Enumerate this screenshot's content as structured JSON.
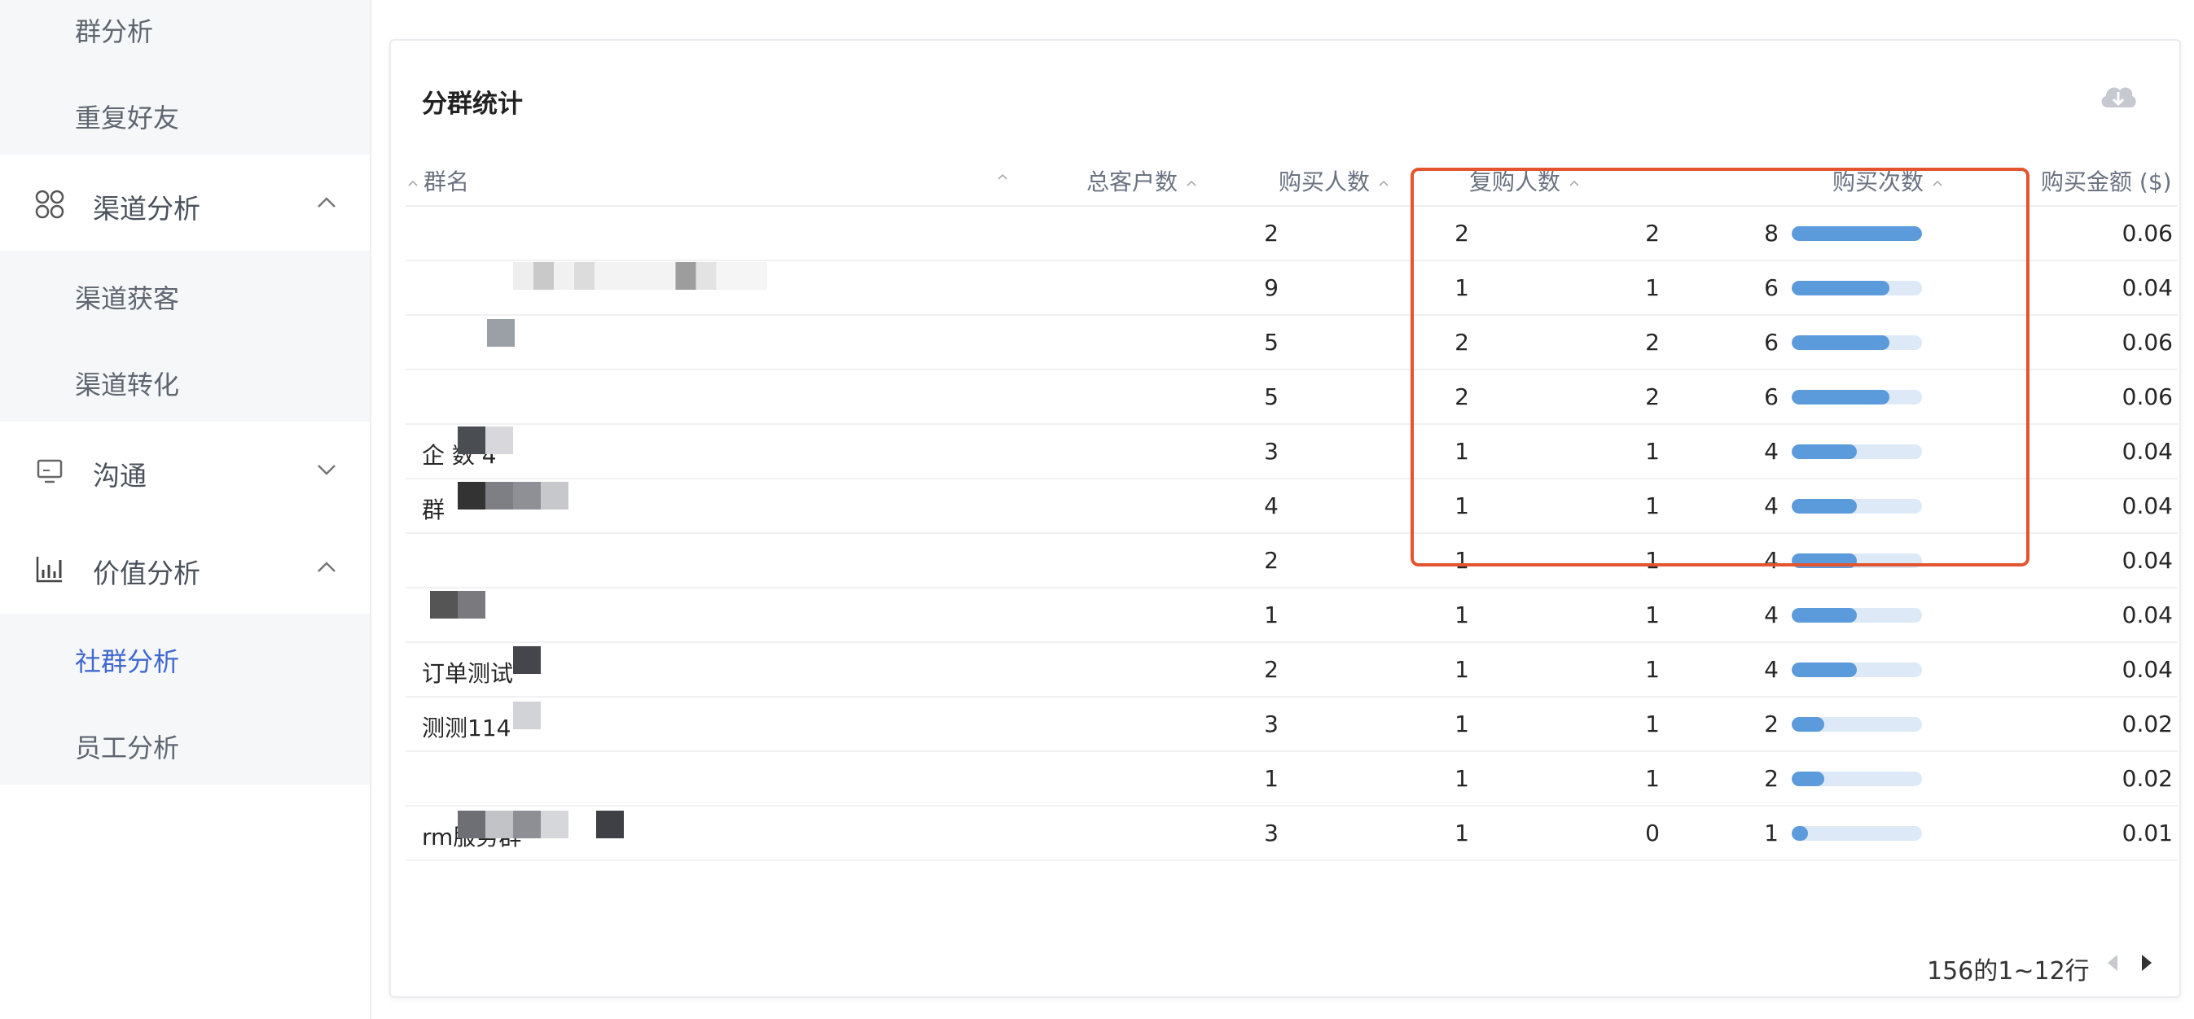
{
  "sidebar": {
    "top_items": [
      "群分析",
      "重复好友"
    ],
    "channel": {
      "label": "渠道分析",
      "icon": "channel-grid-icon",
      "items": [
        "渠道获客",
        "渠道转化"
      ]
    },
    "communication": {
      "label": "沟通",
      "icon": "monitor-icon"
    },
    "value": {
      "label": "价值分析",
      "icon": "bar-chart-icon",
      "items": [
        "社群分析",
        "员工分析"
      ],
      "active": "社群分析"
    }
  },
  "card": {
    "title": "分群统计",
    "download_icon": "cloud-download-icon",
    "columns": {
      "name": "群名",
      "total_customers": "总客户数",
      "buyers": "购买人数",
      "repeat_buyers": "复购人数",
      "purchase_count": "购买次数",
      "purchase_amount": "购买金额 ($)"
    },
    "rows": [
      {
        "name": "",
        "total": "2",
        "buyers": "2",
        "repeat": "2",
        "count": "8",
        "count_value": 8,
        "amount": "0.06"
      },
      {
        "name": "",
        "total": "9",
        "buyers": "1",
        "repeat": "1",
        "count": "6",
        "count_value": 6,
        "amount": "0.04"
      },
      {
        "name": "",
        "total": "5",
        "buyers": "2",
        "repeat": "2",
        "count": "6",
        "count_value": 6,
        "amount": "0.06"
      },
      {
        "name": "",
        "total": "5",
        "buyers": "2",
        "repeat": "2",
        "count": "6",
        "count_value": 6,
        "amount": "0.06"
      },
      {
        "name": "企 数 4",
        "total": "3",
        "buyers": "1",
        "repeat": "1",
        "count": "4",
        "count_value": 4,
        "amount": "0.04"
      },
      {
        "name": "群",
        "total": "4",
        "buyers": "1",
        "repeat": "1",
        "count": "4",
        "count_value": 4,
        "amount": "0.04"
      },
      {
        "name": "",
        "total": "2",
        "buyers": "1",
        "repeat": "1",
        "count": "4",
        "count_value": 4,
        "amount": "0.04"
      },
      {
        "name": "",
        "total": "1",
        "buyers": "1",
        "repeat": "1",
        "count": "4",
        "count_value": 4,
        "amount": "0.04"
      },
      {
        "name": "订单测试",
        "total": "2",
        "buyers": "1",
        "repeat": "1",
        "count": "4",
        "count_value": 4,
        "amount": "0.04"
      },
      {
        "name": "测测114",
        "total": "3",
        "buyers": "1",
        "repeat": "1",
        "count": "2",
        "count_value": 2,
        "amount": "0.02"
      },
      {
        "name": "",
        "total": "1",
        "buyers": "1",
        "repeat": "1",
        "count": "2",
        "count_value": 2,
        "amount": "0.02"
      },
      {
        "name": "rm服务群",
        "total": "3",
        "buyers": "1",
        "repeat": "0",
        "count": "1",
        "count_value": 1,
        "amount": "0.01"
      }
    ],
    "count_max": 8,
    "pagination": {
      "text": "156的1~12行",
      "prev_icon": "caret-left-icon",
      "next_icon": "caret-right-icon"
    }
  },
  "colors": {
    "accent": "#3f68d0",
    "highlight": "#e2552f",
    "bar": "#5b9bdc",
    "bar_track": "#dde9f6"
  }
}
